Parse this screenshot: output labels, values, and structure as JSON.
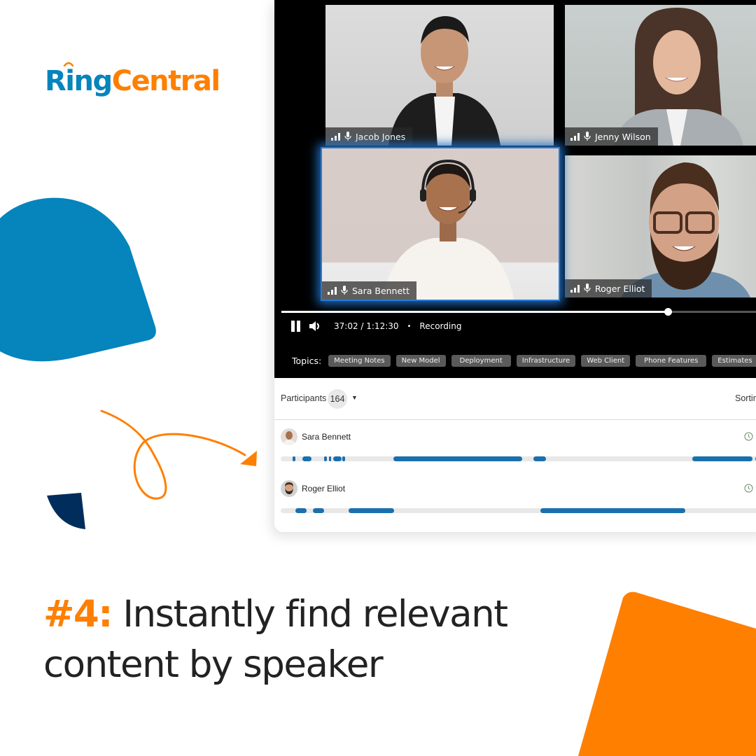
{
  "brand": {
    "logo_part1": "Ring",
    "logo_part2": "Central",
    "colors": {
      "blue": "#0684bc",
      "orange": "#ff7f00",
      "navy": "#012d5c",
      "timeline_blue": "#1b6fad",
      "active_glow": "#2a7ad6"
    }
  },
  "headline": {
    "number": "#4:",
    "line1": " Instantly find relevant",
    "line2": "content by speaker"
  },
  "video_tiles": [
    {
      "name": "Jacob Jones",
      "active": false
    },
    {
      "name": "Jenny Wilson",
      "active": false
    },
    {
      "name": "Sara Bennett",
      "active": true
    },
    {
      "name": "Roger Elliot",
      "active": false
    }
  ],
  "player": {
    "progress": 0.8,
    "time_current": "37:02",
    "time_total": "1:12:30",
    "time_display": "37:02 / 1:12:30",
    "separator": "•",
    "status": "Recording",
    "topics_label": "Topics:",
    "topics": [
      "Meeting Notes",
      "New Model",
      "Deployment",
      "Infrastructure",
      "Web Client",
      "Phone Features",
      "Estimates"
    ]
  },
  "participants": {
    "label": "Participants",
    "count": "164",
    "sort_label": "Sortin",
    "rows": [
      {
        "name": "Sara Bennett",
        "segments": [
          [
            0.025,
            0.028
          ],
          [
            0.045,
            0.064
          ],
          [
            0.09,
            0.093
          ],
          [
            0.1,
            0.104
          ],
          [
            0.108,
            0.126
          ],
          [
            0.128,
            0.134
          ],
          [
            0.233,
            0.5
          ],
          [
            0.523,
            0.55
          ],
          [
            0.852,
            0.977
          ],
          [
            0.982,
            1.0
          ]
        ]
      },
      {
        "name": "Roger Elliot",
        "segments": [
          [
            0.03,
            0.054
          ],
          [
            0.067,
            0.09
          ],
          [
            0.14,
            0.235
          ],
          [
            0.538,
            0.837
          ]
        ]
      }
    ]
  }
}
